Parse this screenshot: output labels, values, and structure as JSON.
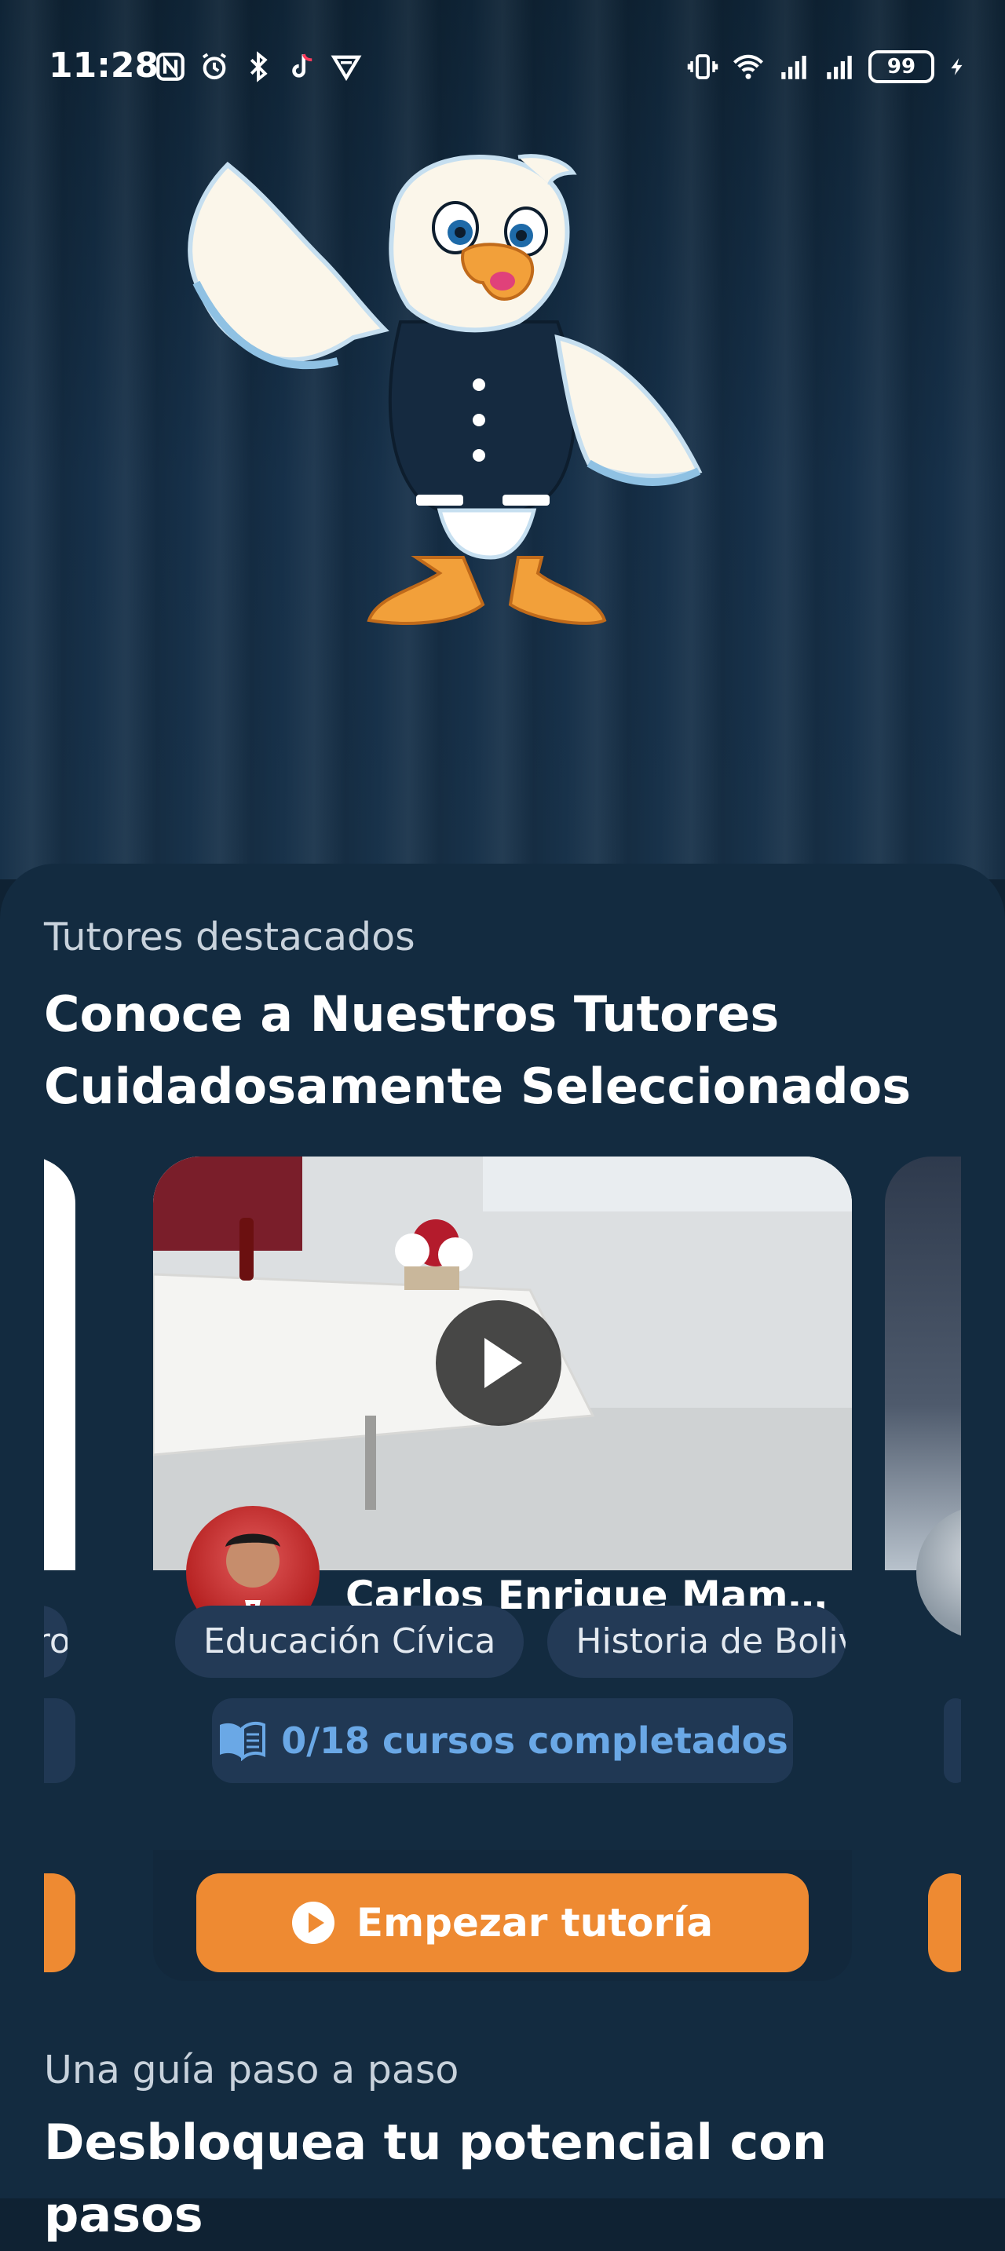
{
  "status": {
    "time": "11:28",
    "battery": "99",
    "icons_left": [
      "nfc-icon",
      "alarm-icon",
      "bluetooth-icon",
      "tiktok-icon",
      "vpn-icon"
    ],
    "icons_right": [
      "vibrate-icon",
      "wifi-icon",
      "signal-icon",
      "signal-icon",
      "battery-icon",
      "charging-icon"
    ]
  },
  "tutors": {
    "eyebrow": "Tutores destacados",
    "title": "Conoce a Nuestros Tutores Cuidadosamente Seleccionados",
    "cards": [
      {
        "name": "Carlos Enrique Mama...",
        "chips": [
          "Educación Cívica",
          "Historia de Boliv"
        ],
        "progress": "0/18 cursos completados",
        "cta": "Empezar tutoría"
      }
    ],
    "left_partial_chip": "Prog"
  },
  "guide": {
    "eyebrow": "Una guía paso a paso",
    "title": "Desbloquea tu potencial con pasos"
  },
  "colors": {
    "accent": "#ee8a32",
    "background": "#132b40",
    "chip": "#233a56",
    "progress_text": "#6aa8e6"
  }
}
